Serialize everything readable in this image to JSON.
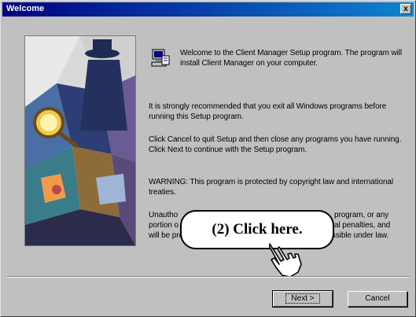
{
  "window": {
    "title": "Welcome",
    "close_glyph": "x"
  },
  "content": {
    "intro": "Welcome to the Client Manager Setup program. The program will install Client Manager on your computer.",
    "recommend": "It is strongly recommended that you exit all Windows programs before running this Setup program.",
    "cancel_info": "Click Cancel to quit Setup and then close any programs you have running. Click Next to continue with the Setup program.",
    "warning": "WARNING: This program is protected by copyright law and international treaties.",
    "unauth_line1_a": "Unautho",
    "unauth_line1_b": "program, or any",
    "unauth_line2_a": "portion o",
    "unauth_line2_b": "al penalties, and",
    "unauth_line3_a": "will be prosec",
    "unauth_line3_b": "possible under law."
  },
  "buttons": {
    "next_label": "Next >",
    "cancel_label": "Cancel"
  },
  "callout": {
    "text": "(2)  Click here."
  },
  "icons": {
    "setup": "setup-computer-icon",
    "pointer": "hand-pointer-icon",
    "art": "detective-illustration"
  },
  "colors": {
    "titlebar_start": "#000080",
    "titlebar_end": "#1084d0",
    "dialog_bg": "#c0c0c0"
  }
}
